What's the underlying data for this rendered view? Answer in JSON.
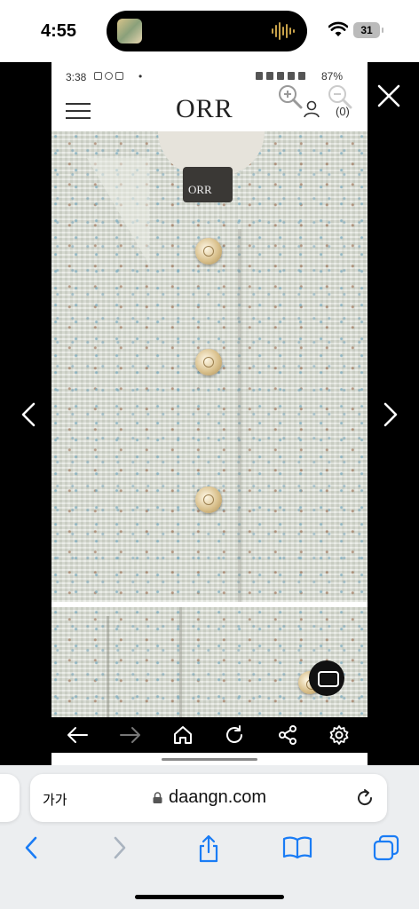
{
  "ios_status": {
    "time": "4:55",
    "battery": "31",
    "icons": [
      "now-playing-thumbnail",
      "audio-waveform-icon",
      "wifi-icon",
      "battery-icon"
    ]
  },
  "viewer": {
    "icons": [
      "close-icon",
      "chevron-left-icon",
      "chevron-right-icon"
    ]
  },
  "android_status": {
    "time": "3:38",
    "dot": "•",
    "battery": "87%"
  },
  "site": {
    "logo": "ORR",
    "cart_count": "(0)",
    "inner_label": "ORR"
  },
  "browser_nav": {
    "icons": [
      "back-arrow-icon",
      "forward-arrow-icon",
      "home-icon",
      "refresh-icon",
      "share-icon",
      "settings-icon"
    ]
  },
  "safari": {
    "text_size": "가가",
    "url": "daangn.com",
    "toolbar_icons": [
      "chevron-left-icon",
      "chevron-right-icon",
      "share-icon",
      "bookmarks-icon",
      "tabs-icon"
    ]
  }
}
